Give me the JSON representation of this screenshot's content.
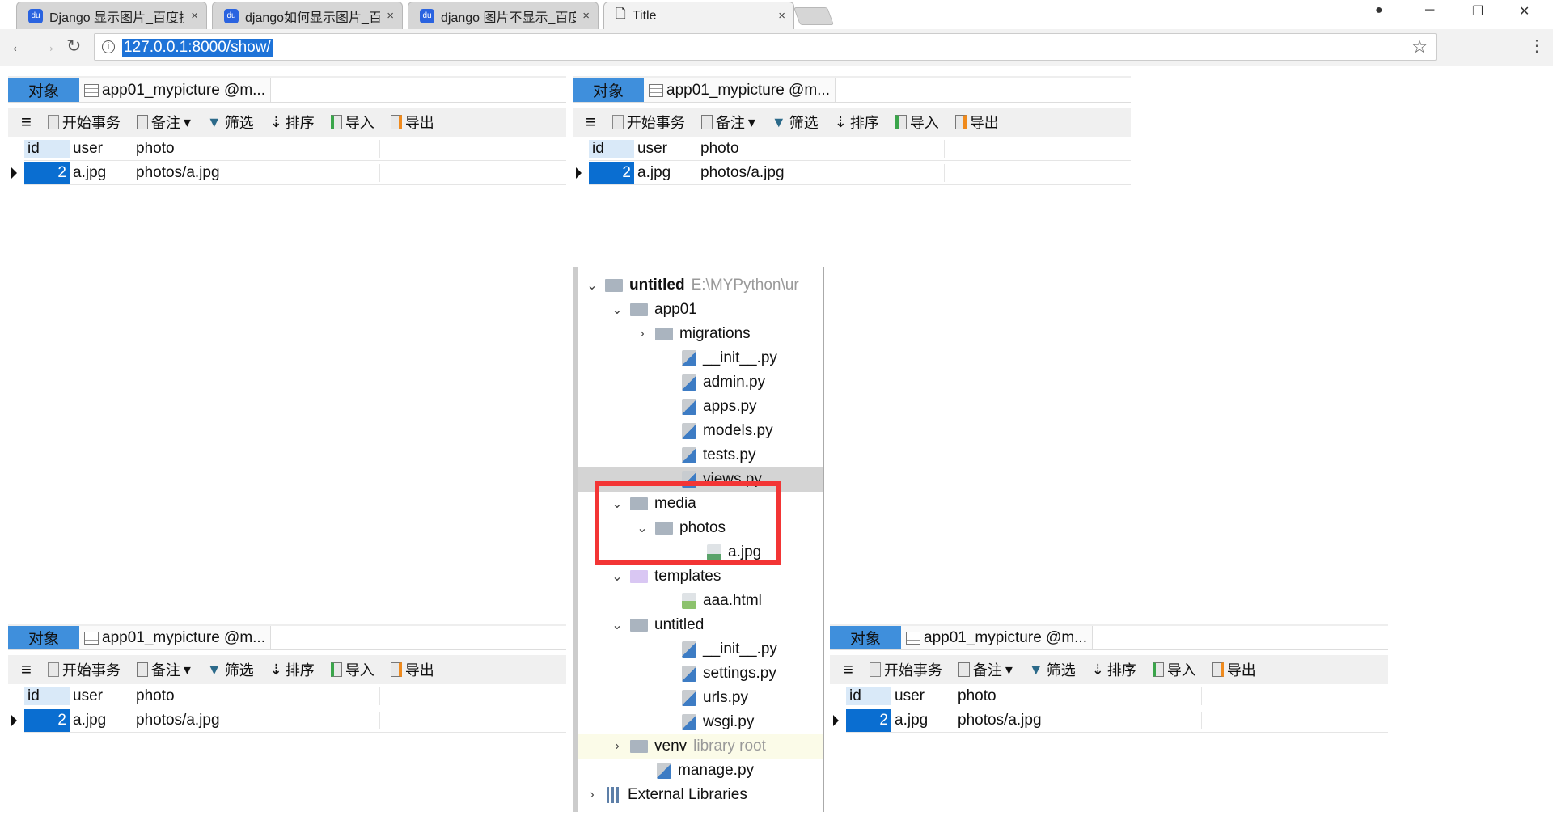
{
  "browser": {
    "tabs": [
      {
        "title": "Django 显示图片_百度搜",
        "icon": "baidu-paw-icon"
      },
      {
        "title": "django如何显示图片_百",
        "icon": "baidu-paw-icon"
      },
      {
        "title": "django 图片不显示_百度",
        "icon": "baidu-paw-icon"
      },
      {
        "title": "Title",
        "icon": "page-icon",
        "active": true
      }
    ],
    "close_glyph": "×",
    "url": "127.0.0.1:8000/show/"
  },
  "panels": [
    {
      "obj_tab": "对象",
      "table_tab": "app01_mypicture @m...",
      "toolbar": {
        "begin": "开始事务",
        "memo": "备注",
        "filter": "筛选",
        "sort": "排序",
        "import": "导入",
        "export": "导出"
      },
      "columns": [
        "id",
        "user",
        "photo"
      ],
      "rows": [
        [
          "2",
          "a.jpg",
          "photos/a.jpg"
        ]
      ]
    },
    {
      "obj_tab": "对象",
      "table_tab": "app01_mypicture @m...",
      "toolbar": {
        "begin": "开始事务",
        "memo": "备注",
        "filter": "筛选",
        "sort": "排序",
        "import": "导入",
        "export": "导出"
      },
      "columns": [
        "id",
        "user",
        "photo"
      ],
      "rows": [
        [
          "2",
          "a.jpg",
          "photos/a.jpg"
        ]
      ]
    },
    {
      "obj_tab": "对象",
      "table_tab": "app01_mypicture @m...",
      "toolbar": {
        "begin": "开始事务",
        "memo": "备注",
        "filter": "筛选",
        "sort": "排序",
        "import": "导入",
        "export": "导出"
      },
      "columns": [
        "id",
        "user",
        "photo"
      ],
      "rows": [
        [
          "2",
          "a.jpg",
          "photos/a.jpg"
        ]
      ]
    },
    {
      "obj_tab": "对象",
      "table_tab": "app01_mypicture @m...",
      "toolbar": {
        "begin": "开始事务",
        "memo": "备注",
        "filter": "筛选",
        "sort": "排序",
        "import": "导入",
        "export": "导出"
      },
      "columns": [
        "id",
        "user",
        "photo"
      ],
      "rows": [
        [
          "2",
          "a.jpg",
          "photos/a.jpg"
        ]
      ]
    }
  ],
  "tree": [
    {
      "label": "untitled",
      "hint": "E:\\MYPython\\ur",
      "depth": 0,
      "type": "folder",
      "state": "open",
      "bold": true
    },
    {
      "label": "app01",
      "depth": 1,
      "type": "folder",
      "state": "open"
    },
    {
      "label": "migrations",
      "depth": 2,
      "type": "folder",
      "state": "closed"
    },
    {
      "label": "__init__.py",
      "depth": 3,
      "type": "py"
    },
    {
      "label": "admin.py",
      "depth": 3,
      "type": "py"
    },
    {
      "label": "apps.py",
      "depth": 3,
      "type": "py"
    },
    {
      "label": "models.py",
      "depth": 3,
      "type": "py"
    },
    {
      "label": "tests.py",
      "depth": 3,
      "type": "py"
    },
    {
      "label": "views.py",
      "depth": 3,
      "type": "py",
      "selected": true
    },
    {
      "label": "media",
      "depth": 1,
      "type": "folder",
      "state": "open"
    },
    {
      "label": "photos",
      "depth": 2,
      "type": "folder",
      "state": "open"
    },
    {
      "label": "a.jpg",
      "depth": 4,
      "type": "img"
    },
    {
      "label": "templates",
      "depth": 1,
      "type": "templates",
      "state": "open"
    },
    {
      "label": "aaa.html",
      "depth": 3,
      "type": "html"
    },
    {
      "label": "untitled",
      "depth": 1,
      "type": "folder",
      "state": "open"
    },
    {
      "label": "__init__.py",
      "depth": 3,
      "type": "py"
    },
    {
      "label": "settings.py",
      "depth": 3,
      "type": "py"
    },
    {
      "label": "urls.py",
      "depth": 3,
      "type": "py"
    },
    {
      "label": "wsgi.py",
      "depth": 3,
      "type": "py"
    },
    {
      "label": "venv",
      "hint": "library root",
      "depth": 1,
      "type": "folder",
      "state": "closed",
      "lib": true
    },
    {
      "label": "manage.py",
      "depth": 2,
      "type": "py"
    },
    {
      "label": "External Libraries",
      "depth": 0,
      "type": "lib",
      "state": "closed"
    }
  ],
  "highlight_color": "#f33535",
  "selection_color": "#0a6ed1"
}
